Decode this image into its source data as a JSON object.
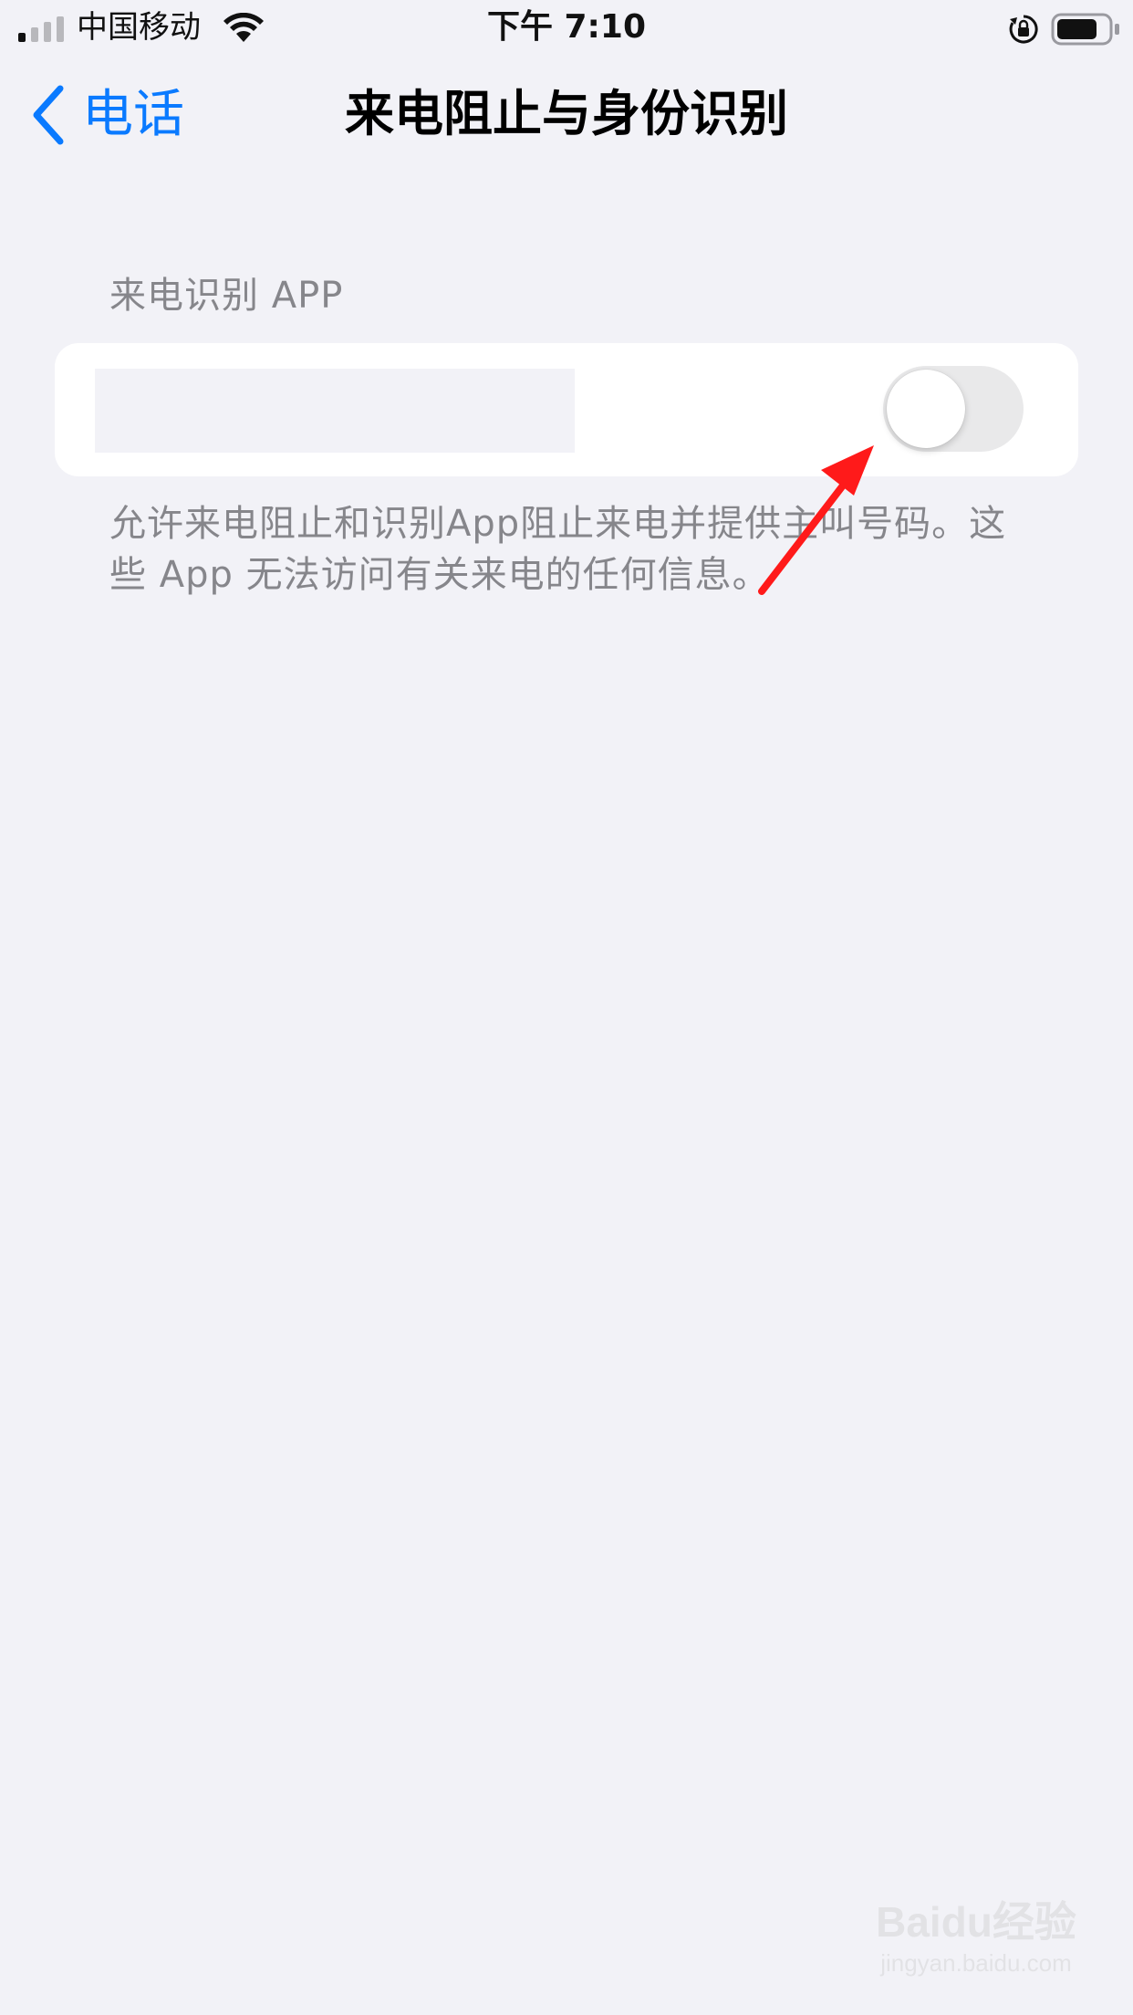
{
  "status_bar": {
    "carrier": "中国移动",
    "time": "下午 7:10",
    "signal_icon": "signal-bars-icon",
    "wifi_icon": "wifi-icon",
    "orientation_lock_icon": "orientation-lock-icon",
    "battery_icon": "battery-icon",
    "battery_level": 0.8
  },
  "nav": {
    "back_label": "电话",
    "title": "来电阻止与身份识别",
    "accent_color": "#0a7aff"
  },
  "section": {
    "header": "来电识别 APP",
    "rows": [
      {
        "toggle_on": false
      }
    ],
    "footer": "允许来电阻止和识别App阻止来电并提供主叫号码。这些 App 无法访问有关来电的任何信息。"
  },
  "annotation": {
    "arrow_color": "#ff1a1a"
  },
  "watermark": {
    "brand": "Baidu经验",
    "sub": "jingyan.baidu.com"
  }
}
